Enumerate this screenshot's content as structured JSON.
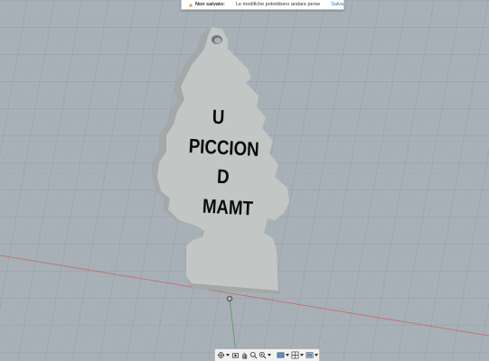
{
  "notification": {
    "icon": "warning-icon",
    "title": "Non salvato:",
    "message": "Le modifiche potrebbero andare perse",
    "action": "Salva"
  },
  "model": {
    "lines": [
      "U",
      "PICCION",
      "D",
      "MAMT"
    ]
  },
  "navbar": {
    "tools": [
      "orbit-icon",
      "look-at-icon",
      "pan-icon",
      "zoom-icon",
      "fit-icon",
      "display-mode-icon",
      "grid-icon",
      "viewports-icon"
    ]
  },
  "colors": {
    "grid_background": "#a9b1b8",
    "grid_line": "#98a1a9",
    "model_body": "#c2c6c5",
    "text": "#0b0b0b",
    "axis_red": "#c26a6a",
    "axis_green": "#4f9a5a",
    "link": "#1a73c8"
  }
}
